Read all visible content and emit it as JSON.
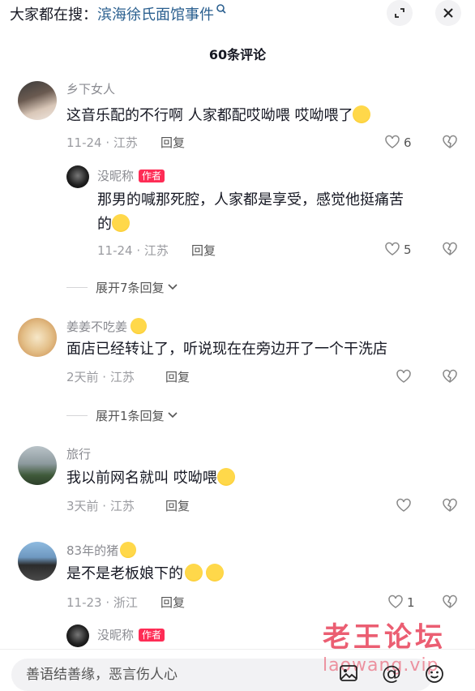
{
  "header": {
    "search_prefix": "大家都在搜：",
    "search_term": "滨海徐氏面馆事件",
    "comment_count": "60条评论"
  },
  "comments": [
    {
      "user": "乡下女人",
      "text": "这音乐配的不行啊 人家都配哎呦喂 哎呦喂了",
      "meta": "11-24 · 江苏",
      "reply": "回复",
      "likes": "6"
    },
    {
      "user": "没昵称",
      "badge": "作者",
      "text_line1": "那男的喊那死腔，人家都是享受，感觉他挺痛苦",
      "text_line2": "的",
      "meta": "11-24 · 江苏",
      "reply": "回复",
      "likes": "5"
    },
    {
      "expand": "展开7条回复"
    },
    {
      "user": "姜姜不吃姜",
      "text": "面店已经转让了，听说现在在旁边开了一个干洗店",
      "meta": "2天前 · 江苏",
      "reply": "回复"
    },
    {
      "expand": "展开1条回复"
    },
    {
      "user": "旅行",
      "text": "我以前网名就叫 哎呦喂",
      "meta": "3天前 · 江苏",
      "reply": "回复"
    },
    {
      "user": "83年的猪",
      "text": "是不是老板娘下的",
      "meta": "11-23 · 浙江",
      "reply": "回复",
      "likes": "1"
    },
    {
      "user": "没昵称",
      "badge": "作者"
    }
  ],
  "input": {
    "placeholder": "善语结善缘，恶言伤人心"
  },
  "watermark": {
    "title": "老王论坛",
    "url": "laowang.vip"
  },
  "colors": {
    "accent": "#fe2c55",
    "link": "#2a5f8f",
    "text": "#161823",
    "muted": "#9a9ba0"
  }
}
